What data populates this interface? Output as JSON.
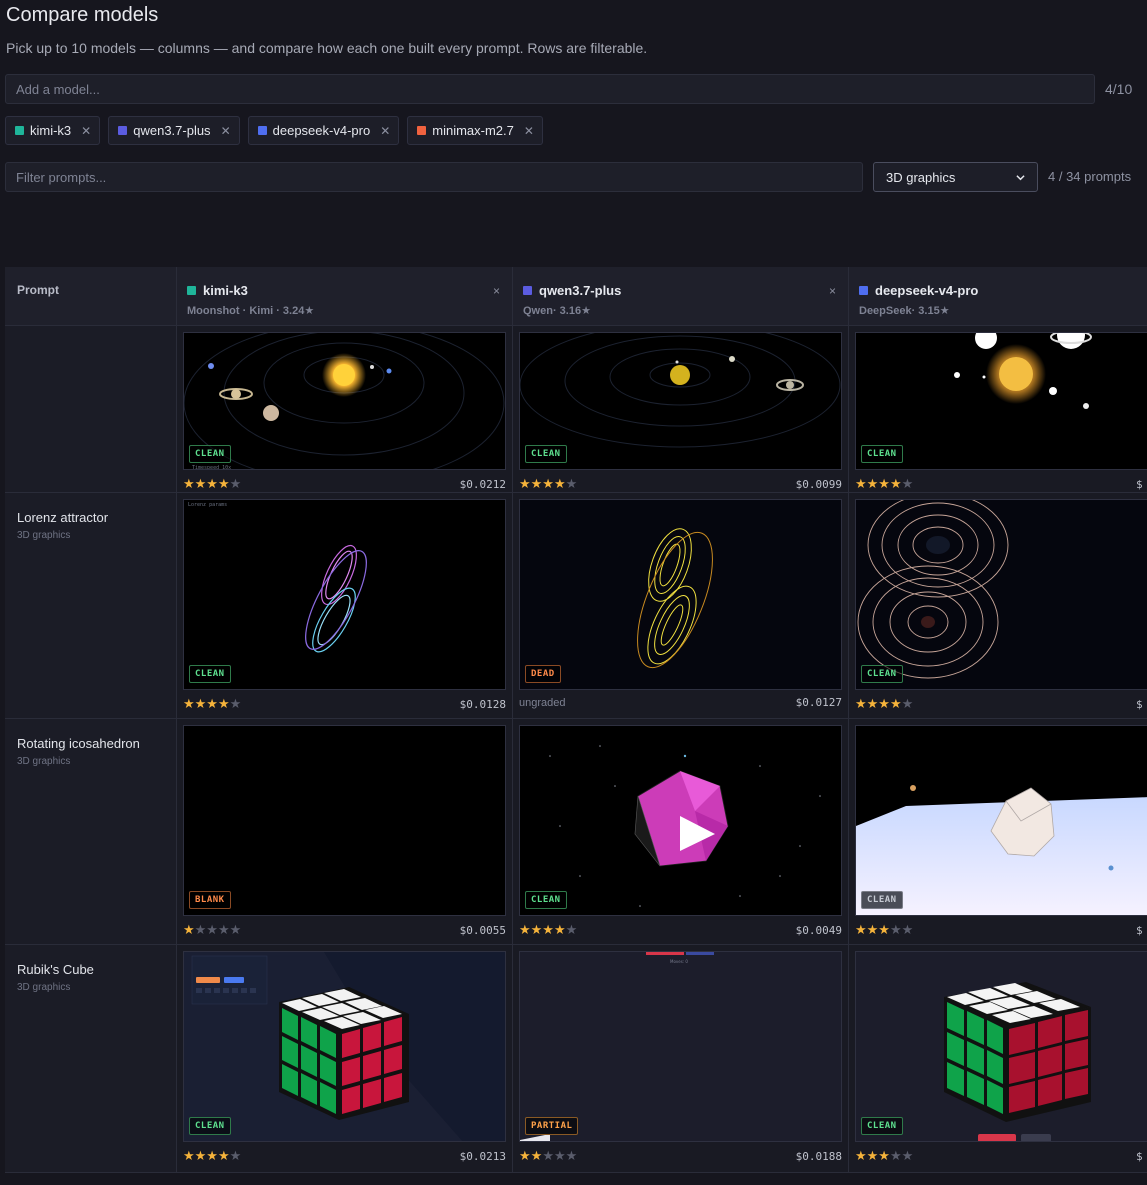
{
  "page": {
    "title": "Compare models",
    "subtitle": "Pick up to 10 models — columns — and compare how each one built every prompt. Rows are filterable."
  },
  "add_model": {
    "placeholder": "Add a model...",
    "count": "4/10"
  },
  "selected_models": [
    {
      "name": "kimi-k3",
      "color": "#1fb59a"
    },
    {
      "name": "qwen3.7-plus",
      "color": "#5b5ce0"
    },
    {
      "name": "deepseek-v4-pro",
      "color": "#4f6ef0"
    },
    {
      "name": "minimax-m2.7",
      "color": "#f0623f"
    }
  ],
  "filter": {
    "placeholder": "Filter prompts...",
    "category": "3D graphics",
    "count": "4 / 34 prompts"
  },
  "grid": {
    "prompt_header": "Prompt",
    "columns": [
      {
        "name": "kimi-k3",
        "meta": "Moonshot · Kimi · 3.24★",
        "color": "#1fb59a",
        "close": "×"
      },
      {
        "name": "qwen3.7-plus",
        "meta": "Qwen· 3.16★",
        "color": "#5b5ce0",
        "close": "×"
      },
      {
        "name": "deepseek-v4-pro",
        "meta": "DeepSeek· 3.15★",
        "color": "#4f6ef0"
      }
    ],
    "rows": [
      {
        "prompt": "",
        "category": "",
        "cells": [
          {
            "badge": "CLEAN",
            "rating": 4,
            "price": "$0.0212"
          },
          {
            "badge": "CLEAN",
            "rating": 4,
            "price": "$0.0099"
          },
          {
            "badge": "CLEAN",
            "rating": 4,
            "price": "$"
          }
        ]
      },
      {
        "prompt": "Lorenz attractor",
        "category": "3D graphics",
        "cells": [
          {
            "badge": "CLEAN",
            "rating": 4,
            "price": "$0.0128"
          },
          {
            "badge": "DEAD",
            "rating": null,
            "grade_text": "ungraded",
            "price": "$0.0127"
          },
          {
            "badge": "CLEAN",
            "rating": 4,
            "price": "$"
          }
        ]
      },
      {
        "prompt": "Rotating icosahedron",
        "category": "3D graphics",
        "cells": [
          {
            "badge": "BLANK",
            "rating": 1,
            "price": "$0.0055"
          },
          {
            "badge": "CLEAN",
            "rating": 4,
            "price": "$0.0049"
          },
          {
            "badge": "CLEAN",
            "rating": 3,
            "price": "$"
          }
        ]
      },
      {
        "prompt": "Rubik's Cube",
        "category": "3D graphics",
        "cells": [
          {
            "badge": "CLEAN",
            "rating": 4,
            "price": "$0.0213"
          },
          {
            "badge": "PARTIAL",
            "rating": 2,
            "price": "$0.0188"
          },
          {
            "badge": "CLEAN",
            "rating": 3,
            "price": "$"
          }
        ]
      }
    ]
  }
}
